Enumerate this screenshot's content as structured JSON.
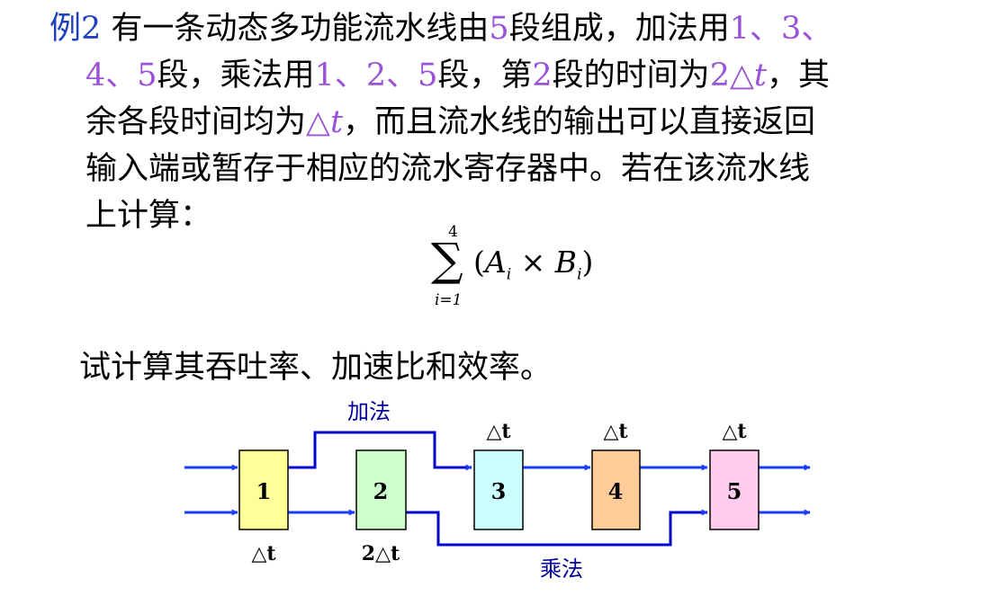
{
  "problem": {
    "lines": [
      [
        {
          "t": "例2",
          "c": "blue"
        },
        {
          "t": " 有一条动态多功能流水线由"
        },
        {
          "t": "5",
          "c": "purple"
        },
        {
          "t": "段组成，加法用"
        },
        {
          "t": "1、3、",
          "c": "purple"
        }
      ],
      [
        {
          "t": "4、5",
          "c": "purple"
        },
        {
          "t": "段，乘法用"
        },
        {
          "t": "1、2、5",
          "c": "purple"
        },
        {
          "t": "段，第"
        },
        {
          "t": "2",
          "c": "purple"
        },
        {
          "t": "段的时间为"
        },
        {
          "t": "2△",
          "c": "purple"
        },
        {
          "t": "t",
          "c": "purple",
          "i": true
        },
        {
          "t": "，其"
        }
      ],
      [
        {
          "t": "余各段时间均为"
        },
        {
          "t": "△",
          "c": "purple"
        },
        {
          "t": "t",
          "c": "purple",
          "i": true
        },
        {
          "t": "，而且流水线的输出可以直接返回"
        }
      ],
      [
        {
          "t": "输入端或暂存于相应的流水寄存器中。若在该流水线"
        }
      ],
      [
        {
          "t": "上计算："
        }
      ]
    ]
  },
  "formula": {
    "upper": "4",
    "sigma": "∑",
    "lower": "i=1",
    "open": "(",
    "a": "A",
    "a_sub": "i",
    "times": " × ",
    "b": "B",
    "b_sub": "i",
    "close": ")"
  },
  "question": "试计算其吞吐率、加速比和效率。",
  "pipeline": {
    "add_label": "加法",
    "mul_label": "乘法",
    "stages": [
      {
        "label": "1",
        "fill": "#ffff99",
        "time": "△t",
        "time_position": "below"
      },
      {
        "label": "2",
        "fill": "#ccffcc",
        "time": "2△t",
        "time_position": "below"
      },
      {
        "label": "3",
        "fill": "#ccffff",
        "time": "△t",
        "time_position": "above"
      },
      {
        "label": "4",
        "fill": "#ffcc99",
        "time": "△t",
        "time_position": "above"
      },
      {
        "label": "5",
        "fill": "#ffccee",
        "time": "△t",
        "time_position": "above"
      }
    ],
    "colors": {
      "path": "#0000cc",
      "arrow": "#1a3cff",
      "label": "#000099"
    }
  }
}
